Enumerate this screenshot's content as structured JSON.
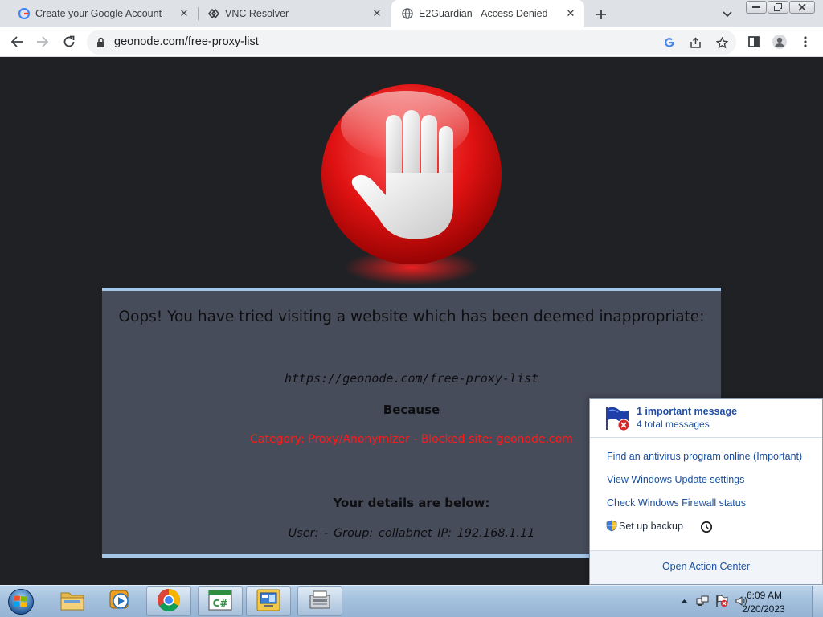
{
  "browser": {
    "tabs": [
      {
        "title": "Create your Google Account",
        "favicon": "google-icon",
        "active": false
      },
      {
        "title": "VNC Resolver",
        "favicon": "vnc-icon",
        "active": false
      },
      {
        "title": "E2Guardian - Access Denied",
        "favicon": "globe-icon",
        "active": true
      }
    ],
    "address_bar": {
      "url": "geonode.com/free-proxy-list"
    }
  },
  "page": {
    "title_message": "Oops! You have tried visiting a website which has been deemed inappropriate:",
    "blocked_url": "https://geonode.com/free-proxy-list",
    "because_label": "Because",
    "reason": "Category: Proxy/Anonymizer - Blocked site: geonode.com",
    "details_heading": "Your details are below:",
    "details_line": "User: -   Group: collabnet   IP: 192.168.1.11",
    "colors": {
      "background": "#202124",
      "panel": "#474c5b",
      "panel_border": "#a6c6e8",
      "reason_text": "#ff1a1a"
    }
  },
  "action_center": {
    "important_message": "1 important message",
    "total_messages": "4 total messages",
    "items": [
      {
        "label": "Find an antivirus program online (Important)"
      },
      {
        "label": "View Windows Update settings"
      },
      {
        "label": "Check Windows Firewall status"
      }
    ],
    "backup_label": "Set up backup",
    "footer_link": "Open Action Center"
  },
  "taskbar": {
    "apps": [
      {
        "name": "explorer",
        "icon": "folder-icon",
        "running": false
      },
      {
        "name": "media-player",
        "icon": "media-player-icon",
        "running": false
      },
      {
        "name": "chrome",
        "icon": "chrome-icon",
        "running": true
      },
      {
        "name": "csharp-editor",
        "icon": "csharp-icon",
        "running": true
      },
      {
        "name": "remote-desktop",
        "icon": "remote-desktop-icon",
        "running": true
      },
      {
        "name": "scanner",
        "icon": "scanner-icon",
        "running": true
      }
    ],
    "clock": {
      "time": "6:09 AM",
      "date": "2/20/2023"
    }
  }
}
